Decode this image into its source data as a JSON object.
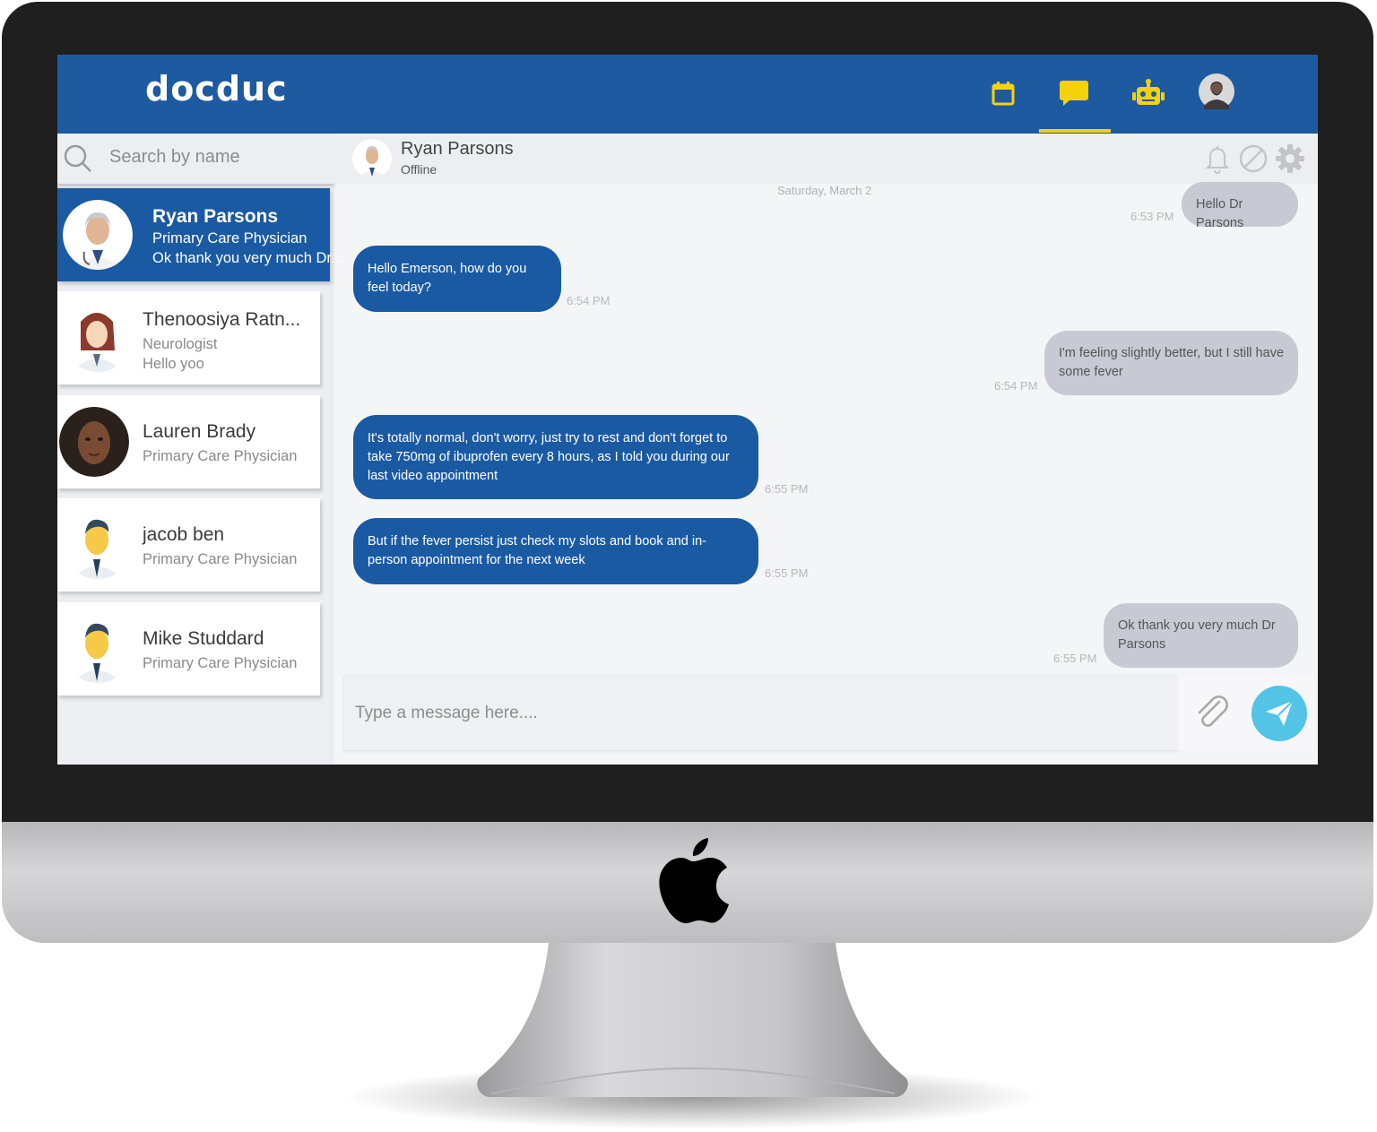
{
  "app": {
    "logo": "docduc"
  },
  "colors": {
    "brand_blue": "#1e5aa0",
    "accent_yellow": "#f5d20b",
    "send_button": "#53c3e6",
    "incoming_bubble": "#1a5aa3",
    "outgoing_bubble": "#c9c9d3"
  },
  "nav": {
    "items": [
      {
        "icon": "calendar-icon"
      },
      {
        "icon": "chat-icon",
        "active": true
      },
      {
        "icon": "robot-icon"
      },
      {
        "icon": "user-avatar"
      }
    ]
  },
  "search": {
    "placeholder": "Search by name"
  },
  "contacts": [
    {
      "name": "Ryan Parsons",
      "specialty": "Primary Care Physician",
      "last_message": "Ok thank you very much Dr...",
      "active": true
    },
    {
      "name": "Thenoosiya Ratn...",
      "specialty": "Neurologist",
      "last_message": "Hello yoo"
    },
    {
      "name": "Lauren Brady",
      "specialty": "Primary Care Physician"
    },
    {
      "name": "jacob ben",
      "specialty": "Primary Care Physician"
    },
    {
      "name": "Mike Studdard",
      "specialty": "Primary Care Physician"
    }
  ],
  "chat": {
    "peer_name": "Ryan Parsons",
    "peer_status": "Offline",
    "date_label": "Saturday, March 2",
    "header_icons": [
      "bell-icon",
      "block-icon",
      "gear-icon"
    ],
    "messages": [
      {
        "direction": "out",
        "text": "Hello Dr Parsons",
        "time": "6:53 PM"
      },
      {
        "direction": "in",
        "text": "Hello Emerson, how do you feel today?",
        "time": "6:54 PM"
      },
      {
        "direction": "out",
        "text": "I'm feeling slightly better, but I still have some fever",
        "time": "6:54 PM"
      },
      {
        "direction": "in",
        "text": "It's totally normal, don't worry, just try to rest and don't forget to take 750mg of ibuprofen every 8 hours, as I told you during our last video appointment",
        "time": "6:55 PM"
      },
      {
        "direction": "in",
        "text": "But if the fever persist just check my slots and book and in-person appointment for the next week",
        "time": "6:55 PM"
      },
      {
        "direction": "out",
        "text": "Ok thank you very much Dr Parsons",
        "time": "6:55 PM"
      }
    ],
    "composer": {
      "placeholder": "Type a message here...."
    }
  }
}
